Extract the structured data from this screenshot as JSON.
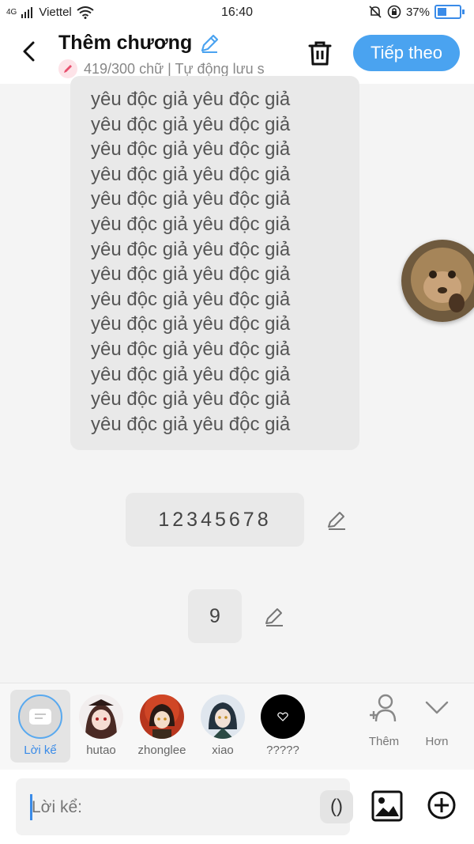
{
  "status_bar": {
    "network": "4G",
    "carrier": "Viettel",
    "time": "16:40",
    "battery": "37%"
  },
  "header": {
    "title": "Thêm chương",
    "subtitle": "419/300 chữ | Tự động lưu s",
    "next_label": "Tiếp theo"
  },
  "content": {
    "text_lines": [
      "yêu độc giả yêu độc giả",
      "yêu độc giả yêu độc giả",
      "yêu độc giả yêu độc giả",
      "yêu độc giả yêu độc giả",
      "yêu độc giả yêu độc giả",
      "yêu độc giả yêu độc giả",
      "yêu độc giả yêu độc giả",
      "yêu độc giả yêu độc giả",
      "yêu độc giả yêu độc giả",
      "yêu độc giả yêu độc giả",
      "yêu độc giả yêu độc giả",
      "yêu độc giả yêu độc giả",
      "yêu độc giả yêu độc giả",
      "yêu độc giả yêu độc giả"
    ],
    "message_1": "12345678",
    "message_2": "9"
  },
  "characters": [
    {
      "label": "Lời kể",
      "active": true
    },
    {
      "label": "hutao",
      "active": false
    },
    {
      "label": "zhonglee",
      "active": false
    },
    {
      "label": "xiao",
      "active": false
    },
    {
      "label": "?????",
      "active": false
    }
  ],
  "actions": {
    "add_label": "Thêm",
    "more_label": "Hơn"
  },
  "input": {
    "placeholder": "Lời kể:",
    "paren_label": "()"
  },
  "colors": {
    "accent": "#4aa3f0",
    "bubble": "#e9e9e9",
    "background": "#f4f4f4"
  }
}
